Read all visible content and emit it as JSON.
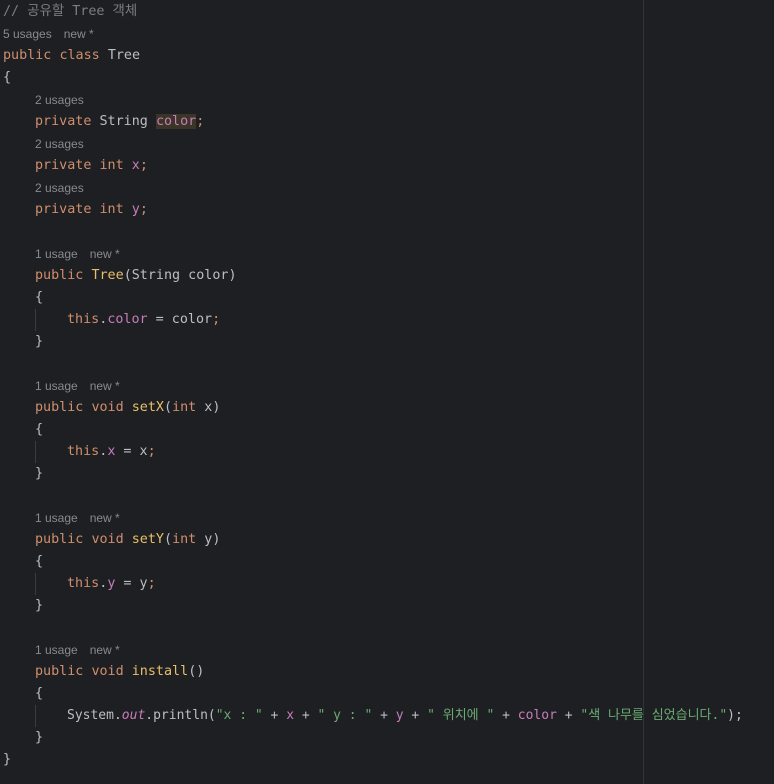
{
  "editor": {
    "comment": "// 공유할 Tree 객체",
    "class_hint_usages": "5 usages",
    "class_hint_new": "new *",
    "class_decl": {
      "kw1": "public",
      "kw2": "class",
      "name": "Tree"
    },
    "open_brace": "{",
    "close_brace": "}",
    "fields": [
      {
        "hint": "2 usages",
        "kw": "private",
        "type": "String",
        "name": "color",
        "semi": ";"
      },
      {
        "hint": "2 usages",
        "kw": "private",
        "type": "int",
        "name": "x",
        "semi": ";"
      },
      {
        "hint": "2 usages",
        "kw": "private",
        "type": "int",
        "name": "y",
        "semi": ";"
      }
    ],
    "constructor": {
      "hint_usages": "1 usage",
      "hint_new": "new *",
      "kw": "public",
      "name": "Tree",
      "params": "(String color)",
      "body_this": "this",
      "body_dot": ".",
      "body_field": "color",
      "body_rest": " = color",
      "body_semi": ";"
    },
    "setX": {
      "hint_usages": "1 usage",
      "hint_new": "new *",
      "kw1": "public",
      "kw2": "void",
      "name": "setX",
      "paren_open": "(",
      "ptype": "int",
      "pname": " x)",
      "body_this": "this",
      "body_dot": ".",
      "body_field": "x",
      "body_rest": " = x",
      "body_semi": ";"
    },
    "setY": {
      "hint_usages": "1 usage",
      "hint_new": "new *",
      "kw1": "public",
      "kw2": "void",
      "name": "setY",
      "paren_open": "(",
      "ptype": "int",
      "pname": " y)",
      "body_this": "this",
      "body_dot": ".",
      "body_field": "y",
      "body_rest": " = y",
      "body_semi": ";"
    },
    "install": {
      "hint_usages": "1 usage",
      "hint_new": "new *",
      "kw1": "public",
      "kw2": "void",
      "name": "install",
      "params": "()",
      "sys": "System.",
      "out": "out",
      "println": ".println(",
      "s1": "\"x : \"",
      "plus1": " + ",
      "v1": "x",
      "plus2": " + ",
      "s2": "\" y : \"",
      "plus3": " + ",
      "v2": "y",
      "plus4": " + ",
      "s3": "\" 위치에 \"",
      "plus5": " + ",
      "v3": "color",
      "plus6": " + ",
      "s4": "\"색 나무를 심었습니다.\"",
      "close": ");"
    }
  }
}
